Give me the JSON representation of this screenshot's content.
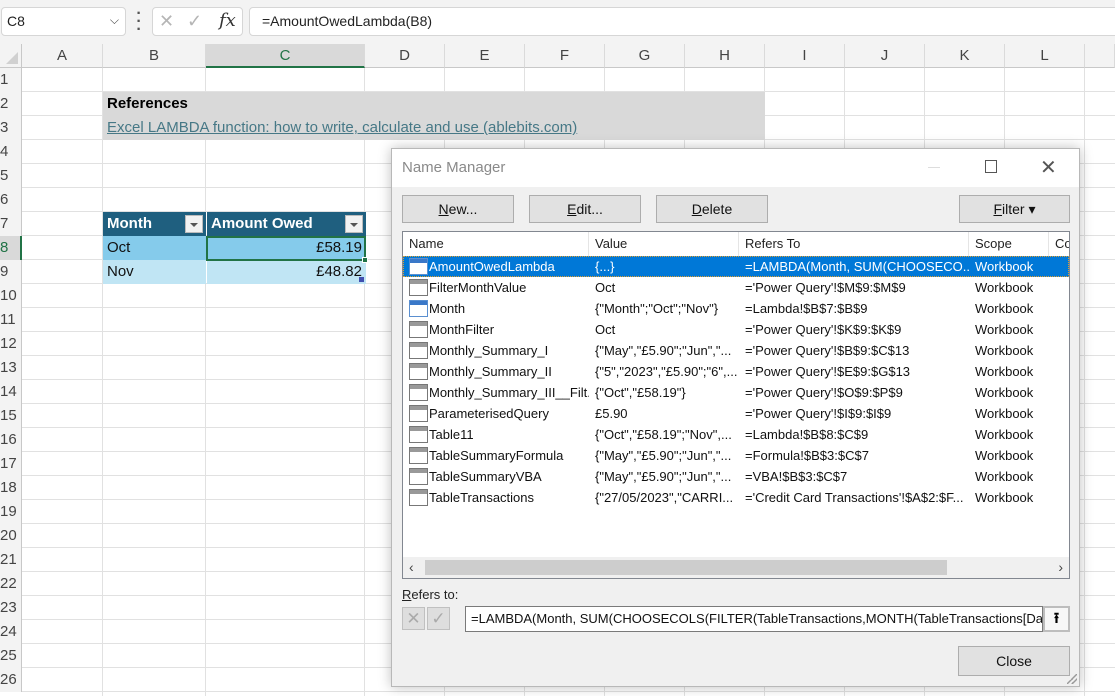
{
  "formula_bar": {
    "name_box": "C8",
    "cancel_icon": "✕",
    "enter_icon": "✓",
    "fx_label": "fx",
    "formula": "=AmountOwedLambda(B8)"
  },
  "sheet": {
    "columns": [
      "A",
      "B",
      "C",
      "D",
      "E",
      "F",
      "G",
      "H",
      "I",
      "J",
      "K",
      "L"
    ],
    "selected_column": "C",
    "rows": [
      "1",
      "2",
      "3",
      "4",
      "5",
      "6",
      "7",
      "8",
      "9",
      "10",
      "11",
      "12",
      "13",
      "14",
      "15",
      "16",
      "17",
      "18",
      "19",
      "20",
      "21",
      "22",
      "23",
      "24",
      "25",
      "26"
    ],
    "selected_row": "8",
    "references_title": "References",
    "references_link": "Excel LAMBDA function: how to write, calculate and use (ablebits.com)",
    "table": {
      "headers": [
        "Month",
        "Amount Owed"
      ],
      "rows": [
        {
          "month": "Oct",
          "amount": "£58.19"
        },
        {
          "month": "Nov",
          "amount": "£48.82"
        }
      ]
    }
  },
  "dialog": {
    "title": "Name Manager",
    "buttons": {
      "new_prefix": "",
      "new_ul": "N",
      "new_rest": "ew...",
      "edit_ul": "E",
      "edit_rest": "dit...",
      "delete_ul": "D",
      "delete_rest": "elete",
      "filter_ul": "F",
      "filter_rest": "ilter ▾",
      "close": "Close"
    },
    "columns": [
      "Name",
      "Value",
      "Refers To",
      "Scope",
      "Comment"
    ],
    "columns_visible": [
      "Name",
      "Value",
      "Refers To",
      "Scope",
      "Co"
    ],
    "names": [
      {
        "icon": "lambda-name-icon",
        "name": "AmountOwedLambda",
        "value": "{...}",
        "refers_to": "=LAMBDA(Month, SUM(CHOOSECO...",
        "scope": "Workbook",
        "selected": true
      },
      {
        "icon": "table-icon",
        "name": "FilterMonthValue",
        "value": "Oct",
        "refers_to": "='Power Query'!$M$9:$M$9",
        "scope": "Workbook"
      },
      {
        "icon": "named-range-icon",
        "name": "Month",
        "value": "{\"Month\";\"Oct\";\"Nov\"}",
        "refers_to": "=Lambda!$B$7:$B$9",
        "scope": "Workbook"
      },
      {
        "icon": "table-icon",
        "name": "MonthFilter",
        "value": "Oct",
        "refers_to": "='Power Query'!$K$9:$K$9",
        "scope": "Workbook"
      },
      {
        "icon": "table-icon",
        "name": "Monthly_Summary_I",
        "value": "{\"May\",\"£5.90\";\"Jun\",\"...",
        "refers_to": "='Power Query'!$B$9:$C$13",
        "scope": "Workbook"
      },
      {
        "icon": "table-icon",
        "name": "Monthly_Summary_II",
        "value": "{\"5\",\"2023\",\"£5.90\";\"6\",...",
        "refers_to": "='Power Query'!$E$9:$G$13",
        "scope": "Workbook"
      },
      {
        "icon": "table-icon",
        "name": "Monthly_Summary_III__Filt...",
        "value": "{\"Oct\",\"£58.19\"}",
        "refers_to": "='Power Query'!$O$9:$P$9",
        "scope": "Workbook"
      },
      {
        "icon": "table-icon",
        "name": "ParameterisedQuery",
        "value": "£5.90",
        "refers_to": "='Power Query'!$I$9:$I$9",
        "scope": "Workbook"
      },
      {
        "icon": "table-icon",
        "name": "Table11",
        "value": "{\"Oct\",\"£58.19\";\"Nov\",...",
        "refers_to": "=Lambda!$B$8:$C$9",
        "scope": "Workbook"
      },
      {
        "icon": "table-icon",
        "name": "TableSummaryFormula",
        "value": "{\"May\",\"£5.90\";\"Jun\",\"...",
        "refers_to": "=Formula!$B$3:$C$7",
        "scope": "Workbook"
      },
      {
        "icon": "table-icon",
        "name": "TableSummaryVBA",
        "value": "{\"May\",\"£5.90\";\"Jun\",\"...",
        "refers_to": "=VBA!$B$3:$C$7",
        "scope": "Workbook"
      },
      {
        "icon": "table-icon",
        "name": "TableTransactions",
        "value": "{\"27/05/2023\",\"CARRI...",
        "refers_to": "='Credit Card Transactions'!$A$2:$F...",
        "scope": "Workbook"
      }
    ],
    "refers_to_label_ul": "R",
    "refers_to_label_rest": "efers to:",
    "refers_to_value": "=LAMBDA(Month, SUM(CHOOSECOLS(FILTER(TableTransactions,MONTH(TableTransactions[Date]",
    "scroll_left": "‹",
    "scroll_right": "›",
    "collapse_icon": "⭱"
  },
  "colors": {
    "table_header": "#1f5f7f",
    "row_band_1": "#85cbeb",
    "row_band_2": "#c0e5f4",
    "selection_green": "#217346",
    "list_selection": "#0078d7",
    "link": "#467886"
  }
}
